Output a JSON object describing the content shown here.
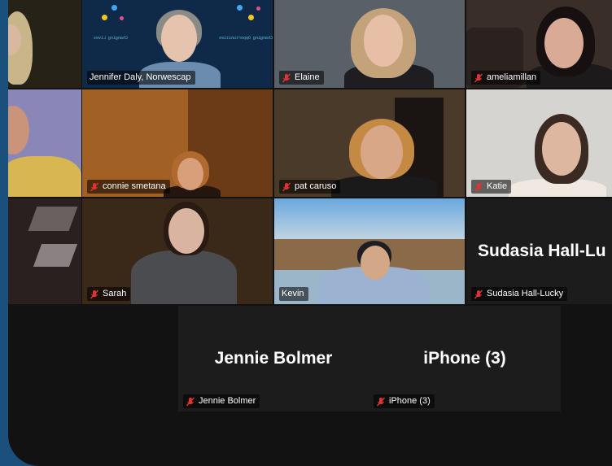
{
  "participants": {
    "jennifer": "Jennifer Daly, Norwescap",
    "elaine": "Elaine",
    "amelia": "ameliamillan",
    "connie": "connie smetana",
    "pat": "pat caruso",
    "katie": "Katie",
    "sarah": "Sarah",
    "kevin": "Kevin",
    "sudasia_label": "Sudasia Hall-Lucky",
    "sudasia_big": "Sudasia  Hall-Lu",
    "jennie_big": "Jennie Bolmer",
    "jennie_label": "Jennie Bolmer",
    "iphone_big": "iPhone (3)",
    "iphone_label": "iPhone (3)"
  },
  "background_text": {
    "left_logo": "Changing Lives",
    "right_logo": "Changing Opportunities"
  },
  "colors": {
    "active_speaker_border": "#2fd36b",
    "mic_muted": "#e0332f",
    "outer_background": "#1b4f7c"
  },
  "icons": {
    "muted_mic": "mic-off-icon"
  }
}
